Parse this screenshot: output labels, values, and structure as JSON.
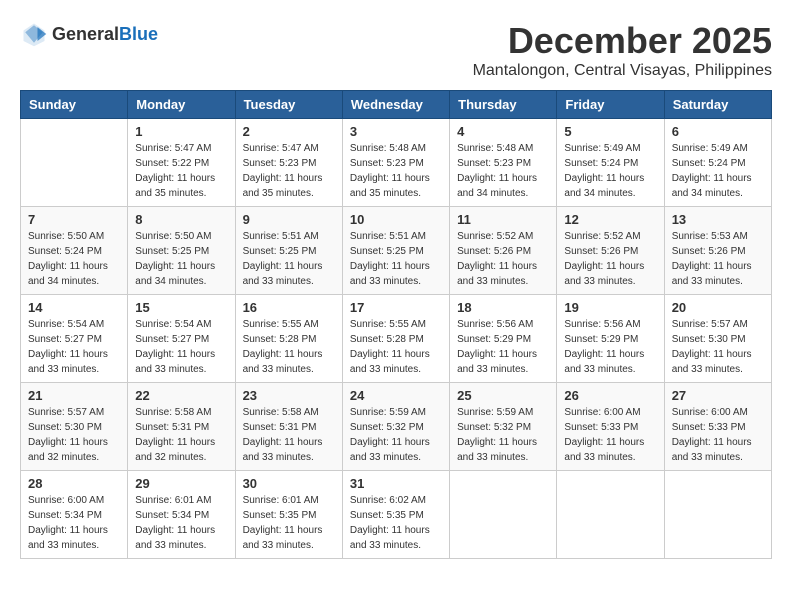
{
  "header": {
    "logo_general": "General",
    "logo_blue": "Blue",
    "month": "December 2025",
    "location": "Mantalongon, Central Visayas, Philippines"
  },
  "weekdays": [
    "Sunday",
    "Monday",
    "Tuesday",
    "Wednesday",
    "Thursday",
    "Friday",
    "Saturday"
  ],
  "weeks": [
    [
      {
        "day": "",
        "info": ""
      },
      {
        "day": "1",
        "info": "Sunrise: 5:47 AM\nSunset: 5:22 PM\nDaylight: 11 hours\nand 35 minutes."
      },
      {
        "day": "2",
        "info": "Sunrise: 5:47 AM\nSunset: 5:23 PM\nDaylight: 11 hours\nand 35 minutes."
      },
      {
        "day": "3",
        "info": "Sunrise: 5:48 AM\nSunset: 5:23 PM\nDaylight: 11 hours\nand 35 minutes."
      },
      {
        "day": "4",
        "info": "Sunrise: 5:48 AM\nSunset: 5:23 PM\nDaylight: 11 hours\nand 34 minutes."
      },
      {
        "day": "5",
        "info": "Sunrise: 5:49 AM\nSunset: 5:24 PM\nDaylight: 11 hours\nand 34 minutes."
      },
      {
        "day": "6",
        "info": "Sunrise: 5:49 AM\nSunset: 5:24 PM\nDaylight: 11 hours\nand 34 minutes."
      }
    ],
    [
      {
        "day": "7",
        "info": "Sunrise: 5:50 AM\nSunset: 5:24 PM\nDaylight: 11 hours\nand 34 minutes."
      },
      {
        "day": "8",
        "info": "Sunrise: 5:50 AM\nSunset: 5:25 PM\nDaylight: 11 hours\nand 34 minutes."
      },
      {
        "day": "9",
        "info": "Sunrise: 5:51 AM\nSunset: 5:25 PM\nDaylight: 11 hours\nand 33 minutes."
      },
      {
        "day": "10",
        "info": "Sunrise: 5:51 AM\nSunset: 5:25 PM\nDaylight: 11 hours\nand 33 minutes."
      },
      {
        "day": "11",
        "info": "Sunrise: 5:52 AM\nSunset: 5:26 PM\nDaylight: 11 hours\nand 33 minutes."
      },
      {
        "day": "12",
        "info": "Sunrise: 5:52 AM\nSunset: 5:26 PM\nDaylight: 11 hours\nand 33 minutes."
      },
      {
        "day": "13",
        "info": "Sunrise: 5:53 AM\nSunset: 5:26 PM\nDaylight: 11 hours\nand 33 minutes."
      }
    ],
    [
      {
        "day": "14",
        "info": "Sunrise: 5:54 AM\nSunset: 5:27 PM\nDaylight: 11 hours\nand 33 minutes."
      },
      {
        "day": "15",
        "info": "Sunrise: 5:54 AM\nSunset: 5:27 PM\nDaylight: 11 hours\nand 33 minutes."
      },
      {
        "day": "16",
        "info": "Sunrise: 5:55 AM\nSunset: 5:28 PM\nDaylight: 11 hours\nand 33 minutes."
      },
      {
        "day": "17",
        "info": "Sunrise: 5:55 AM\nSunset: 5:28 PM\nDaylight: 11 hours\nand 33 minutes."
      },
      {
        "day": "18",
        "info": "Sunrise: 5:56 AM\nSunset: 5:29 PM\nDaylight: 11 hours\nand 33 minutes."
      },
      {
        "day": "19",
        "info": "Sunrise: 5:56 AM\nSunset: 5:29 PM\nDaylight: 11 hours\nand 33 minutes."
      },
      {
        "day": "20",
        "info": "Sunrise: 5:57 AM\nSunset: 5:30 PM\nDaylight: 11 hours\nand 33 minutes."
      }
    ],
    [
      {
        "day": "21",
        "info": "Sunrise: 5:57 AM\nSunset: 5:30 PM\nDaylight: 11 hours\nand 32 minutes."
      },
      {
        "day": "22",
        "info": "Sunrise: 5:58 AM\nSunset: 5:31 PM\nDaylight: 11 hours\nand 32 minutes."
      },
      {
        "day": "23",
        "info": "Sunrise: 5:58 AM\nSunset: 5:31 PM\nDaylight: 11 hours\nand 33 minutes."
      },
      {
        "day": "24",
        "info": "Sunrise: 5:59 AM\nSunset: 5:32 PM\nDaylight: 11 hours\nand 33 minutes."
      },
      {
        "day": "25",
        "info": "Sunrise: 5:59 AM\nSunset: 5:32 PM\nDaylight: 11 hours\nand 33 minutes."
      },
      {
        "day": "26",
        "info": "Sunrise: 6:00 AM\nSunset: 5:33 PM\nDaylight: 11 hours\nand 33 minutes."
      },
      {
        "day": "27",
        "info": "Sunrise: 6:00 AM\nSunset: 5:33 PM\nDaylight: 11 hours\nand 33 minutes."
      }
    ],
    [
      {
        "day": "28",
        "info": "Sunrise: 6:00 AM\nSunset: 5:34 PM\nDaylight: 11 hours\nand 33 minutes."
      },
      {
        "day": "29",
        "info": "Sunrise: 6:01 AM\nSunset: 5:34 PM\nDaylight: 11 hours\nand 33 minutes."
      },
      {
        "day": "30",
        "info": "Sunrise: 6:01 AM\nSunset: 5:35 PM\nDaylight: 11 hours\nand 33 minutes."
      },
      {
        "day": "31",
        "info": "Sunrise: 6:02 AM\nSunset: 5:35 PM\nDaylight: 11 hours\nand 33 minutes."
      },
      {
        "day": "",
        "info": ""
      },
      {
        "day": "",
        "info": ""
      },
      {
        "day": "",
        "info": ""
      }
    ]
  ]
}
